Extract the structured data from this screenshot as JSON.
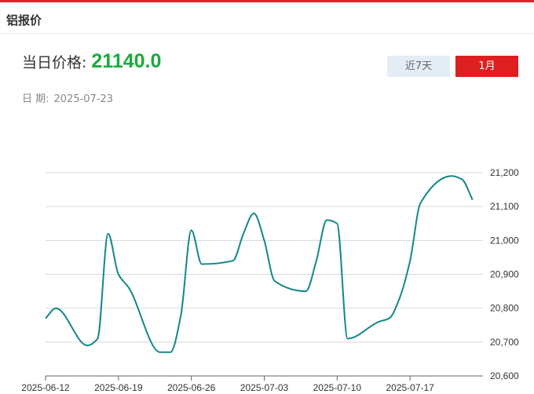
{
  "panel": {
    "title": "铝报价"
  },
  "price": {
    "label": "当日价格:",
    "value": "21140.0"
  },
  "date": {
    "label": "日 期:",
    "value": "2025-07-23"
  },
  "range_buttons": {
    "week": "近7天",
    "month": "1月"
  },
  "colors": {
    "accent": "#dd1f1f",
    "price": "#1aaa3c",
    "line": "#12878a",
    "grid": "#d8d8d8"
  },
  "chart_data": {
    "type": "line",
    "title": "",
    "xlabel": "",
    "ylabel": "",
    "ylim": [
      20600,
      21200
    ],
    "yticks": [
      20600,
      20700,
      20800,
      20900,
      21000,
      21100,
      21200
    ],
    "ytick_labels": [
      "20,600",
      "20,700",
      "20,800",
      "20,900",
      "21,000",
      "21,100",
      "21,200"
    ],
    "xlim": [
      "2025-06-12",
      "2025-07-24"
    ],
    "xticks": [
      "2025-06-12",
      "2025-06-19",
      "2025-06-26",
      "2025-07-03",
      "2025-07-10",
      "2025-07-17"
    ],
    "y_axis_position": "right",
    "grid": "horizontal",
    "series": [
      {
        "x": [
          "2025-06-12",
          "2025-06-13",
          "2025-06-16",
          "2025-06-17",
          "2025-06-18",
          "2025-06-19",
          "2025-06-20",
          "2025-06-23",
          "2025-06-24",
          "2025-06-25",
          "2025-06-26",
          "2025-06-27",
          "2025-06-30",
          "2025-07-01",
          "2025-07-02",
          "2025-07-03",
          "2025-07-04",
          "2025-07-07",
          "2025-07-08",
          "2025-07-09",
          "2025-07-10",
          "2025-07-11",
          "2025-07-14",
          "2025-07-15",
          "2025-07-16",
          "2025-07-17",
          "2025-07-18",
          "2025-07-21",
          "2025-07-22",
          "2025-07-23"
        ],
        "values": [
          20770,
          20800,
          20690,
          20710,
          21020,
          20900,
          20860,
          20670,
          20670,
          20780,
          21030,
          20930,
          20940,
          21020,
          21080,
          21000,
          20880,
          20850,
          20940,
          21060,
          21050,
          20710,
          20760,
          20770,
          20830,
          20940,
          21110,
          21190,
          21180,
          21120
        ]
      }
    ]
  }
}
